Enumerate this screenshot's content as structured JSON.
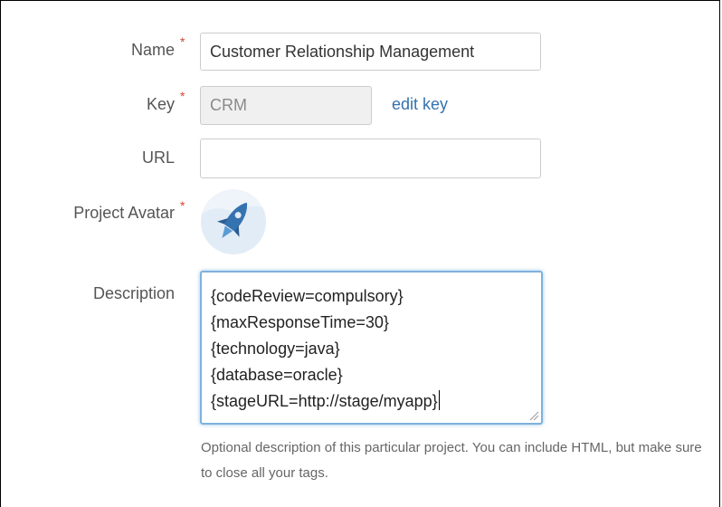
{
  "form": {
    "name": {
      "label": "Name",
      "required_mark": "*",
      "value": "Customer Relationship Management"
    },
    "key": {
      "label": "Key",
      "required_mark": "*",
      "value": "CRM",
      "edit_link": "edit key"
    },
    "url": {
      "label": "URL",
      "value": ""
    },
    "avatar": {
      "label": "Project Avatar",
      "required_mark": "*",
      "icon": "rocket-icon"
    },
    "description": {
      "label": "Description",
      "lines": [
        "{codeReview=compulsory}",
        "{maxResponseTime=30}",
        "{technology=java}",
        "{database=oracle}",
        "{stageURL=http://stage/myapp}"
      ],
      "help_text": "Optional description of this particular project. You can include HTML, but make sure to close all your tags."
    }
  },
  "colors": {
    "required": "#d04437",
    "link": "#3572b0",
    "focus_border": "#7fb1de",
    "rocket": "#3572b0"
  }
}
